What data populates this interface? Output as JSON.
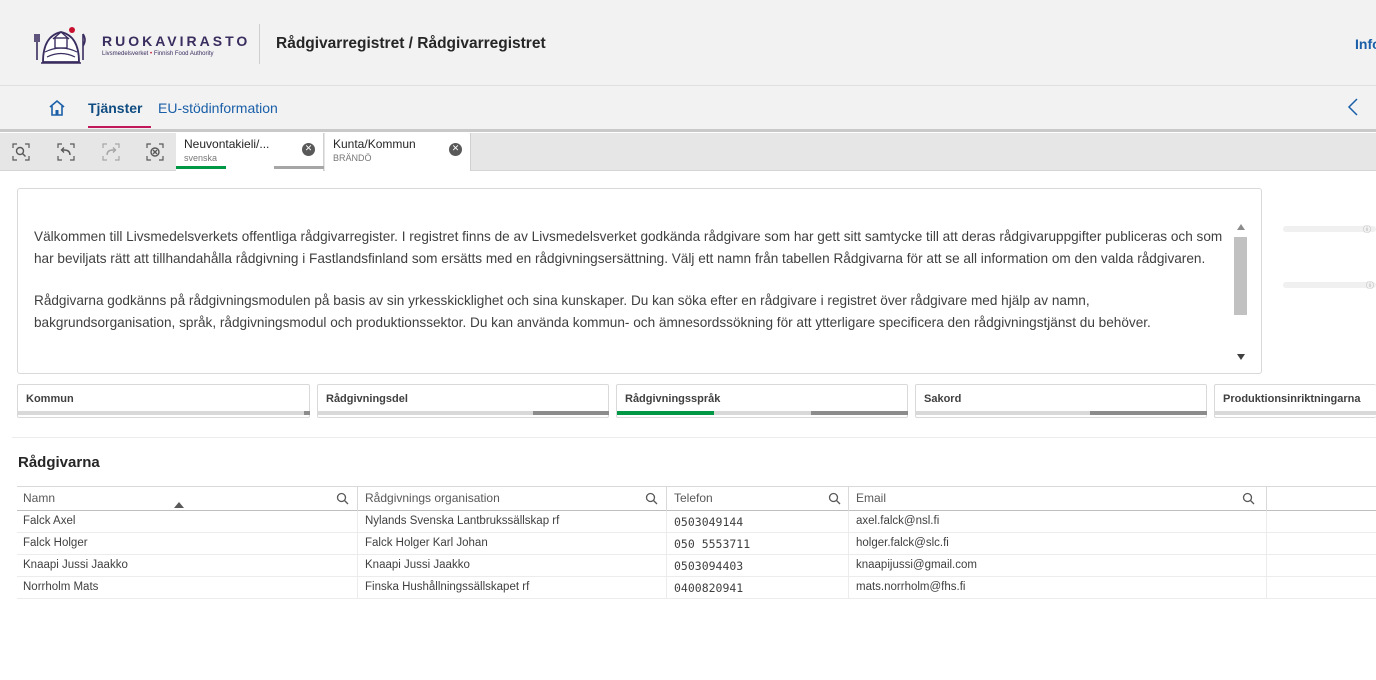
{
  "header": {
    "brand_name": "RUOKAVIRASTO",
    "brand_sub_left": "Livsmedelsverket",
    "brand_sub_sep": "•",
    "brand_sub_right": "Finnish Food Authority",
    "app_title": "Rådgivarregistret / Rådgivarregistret",
    "info_link": "Info"
  },
  "nav": {
    "tabs": [
      {
        "label": "Tjänster",
        "active": true
      },
      {
        "label": "EU-stödinformation",
        "active": false
      }
    ],
    "icons": [
      "home-icon",
      "chevron-left-icon"
    ]
  },
  "selections": {
    "tools": [
      "smart-search-icon",
      "step-back-icon",
      "step-forward-icon",
      "clear-all-selections-icon"
    ],
    "chips": [
      {
        "title": "Neuvontakieli/...",
        "value": "svenska"
      },
      {
        "title": "Kunta/Kommun",
        "value": "BRÄNDÖ"
      }
    ],
    "accent_color": "#009845"
  },
  "intro": {
    "paragraph_1": "Välkommen till Livsmedelsverkets offentliga rådgivarregister. I registret finns de av Livsmedelsverket godkända rådgivare som har gett sitt samtycke till att deras rådgivaruppgifter publiceras och som har beviljats rätt att tillhandahålla rådgivning i Fastlandsfinland som ersätts med en rådgivningsersättning. Välj ett namn från tabellen Rådgivarna för att se all information om den valda rådgivaren.",
    "paragraph_2": "Rådgivarna godkänns på rådgivningsmodulen på basis av sin yrkesskicklighet och sina kunskaper. Du kan söka efter en rådgivare i registret över rådgivare med hjälp av namn, bakgrundsorganisation, språk, rådgivningsmodul och produktionssektor. Du kan använda kommun- och ämnesordssökning för att ytterligare specificera den rådgivningstjänst du behöver."
  },
  "filters": [
    {
      "label": "Kommun",
      "selected": true
    },
    {
      "label": "Rådgivningsdel",
      "selected": false
    },
    {
      "label": "Rådgivningsspråk",
      "selected": true
    },
    {
      "label": "Sakord",
      "selected": false
    },
    {
      "label": "Produktionsinriktningarna",
      "selected": false
    }
  ],
  "table": {
    "title": "Rådgivarna",
    "columns": [
      "Namn",
      "Rådgivnings organisation",
      "Telefon",
      "Email"
    ],
    "sorted_column": "Namn",
    "sort_direction": "ascending",
    "rows": [
      [
        "Falck Axel",
        "Nylands Svenska Lantbrukssällskap rf",
        "0503049144",
        "axel.falck@nsl.fi"
      ],
      [
        "Falck Holger",
        "Falck Holger Karl Johan",
        "050 5553711",
        "holger.falck@slc.fi"
      ],
      [
        "Knaapi Jussi Jaakko",
        "Knaapi Jussi Jaakko",
        "0503094403",
        "knaapijussi@gmail.com"
      ],
      [
        "Norrholm Mats",
        "Finska Hushållningssällskapet rf",
        "0400820941",
        "mats.norrholm@fhs.fi"
      ]
    ]
  },
  "colors": {
    "brand": "#3a2d5f",
    "link": "#1a5fa8",
    "tab_underline": "#c2185b",
    "selected": "#009845"
  }
}
